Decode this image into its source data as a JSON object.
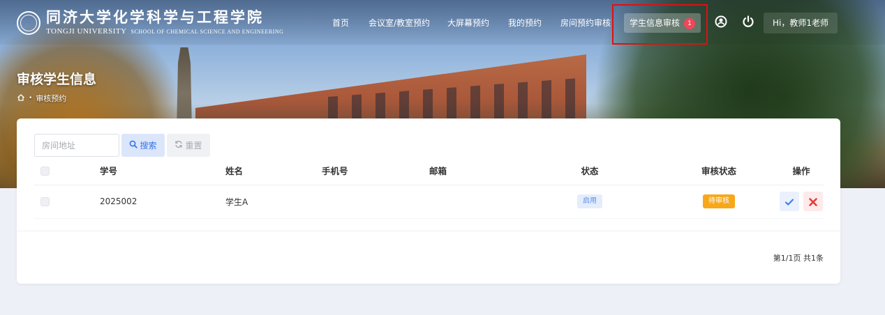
{
  "logo": {
    "cn_name": "同济大学化学科学与工程学院",
    "en_university": "TONGJI UNIVERSITY",
    "en_school": "SCHOOL OF CHEMICAL SCIENCE AND ENGINEERING"
  },
  "nav": {
    "items": [
      {
        "label": "首页"
      },
      {
        "label": "会议室/教室预约"
      },
      {
        "label": "大屏幕预约"
      },
      {
        "label": "我的预约"
      },
      {
        "label": "房间预约审核"
      },
      {
        "label": "学生信息审核",
        "badge": "1",
        "active": true
      }
    ],
    "profile_icon": "user-circle-icon",
    "logout_icon": "power-icon",
    "user_greeting": "Hi，教师1老师"
  },
  "page": {
    "title": "审核学生信息",
    "breadcrumb": {
      "home_icon": "home-icon",
      "current": "审核预约"
    }
  },
  "toolbar": {
    "search_placeholder": "房间地址",
    "search_value": "",
    "search_label": "搜索",
    "reset_label": "重置"
  },
  "table": {
    "headers": [
      "学号",
      "姓名",
      "手机号",
      "邮箱",
      "状态",
      "审核状态",
      "操作"
    ],
    "rows": [
      {
        "id": "2025002",
        "name": "学生A",
        "phone": "",
        "email": "",
        "status": "启用",
        "audit_status": "待审核"
      }
    ]
  },
  "pagination": {
    "text": "第1/1页 共1条"
  },
  "colors": {
    "accent": "#3874e8",
    "badge": "#f2455b",
    "pending": "#f7a81a",
    "reject": "#e63a3a",
    "highlight_box": "#e01010"
  }
}
